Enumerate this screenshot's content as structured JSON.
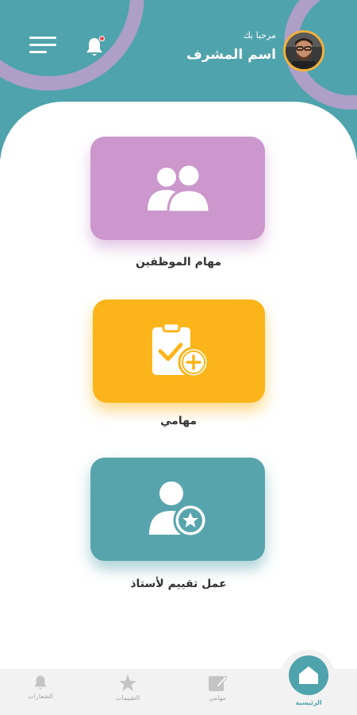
{
  "header": {
    "greeting": "مرحبا بك",
    "user_name": "اسم المشرف"
  },
  "cards": [
    {
      "label": "مهام الموظفين",
      "icon": "users-icon",
      "color": "#cb97cc"
    },
    {
      "label": "مهامي",
      "icon": "clipboard-add-icon",
      "color": "#fbb419"
    },
    {
      "label": "عمل تقييم لأستاذ",
      "icon": "user-star-icon",
      "color": "#58a4ad"
    }
  ],
  "bottom_nav": {
    "home": "الرئيسية",
    "tasks": "مهامي",
    "evaluations": "التقييمات",
    "notifications": "الشعارات"
  },
  "colors": {
    "primary": "#4fa3ad",
    "accent_purple": "#ad9fc6",
    "badge_red": "#e54b4b",
    "avatar_ring": "#f2b13a"
  }
}
